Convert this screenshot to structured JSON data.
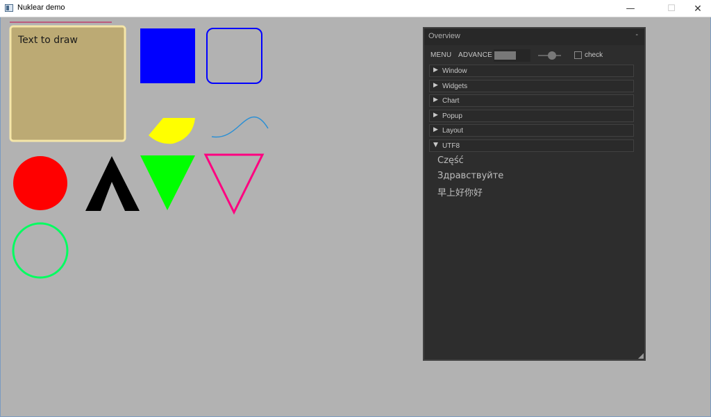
{
  "window": {
    "title": "Nuklear demo",
    "controls": {
      "minimize": "—",
      "maximize": "☐",
      "close": "✕"
    }
  },
  "canvas": {
    "background": "#b2b2b2",
    "text_box": {
      "text": "Text to draw",
      "fill": "#bcaa74",
      "border": "#f5e6a8"
    },
    "shapes": [
      {
        "kind": "filled-square",
        "color": "#0000ff"
      },
      {
        "kind": "outlined-rounded-square",
        "color": "#0000ff"
      },
      {
        "kind": "filled-arc",
        "color": "#ffff00"
      },
      {
        "kind": "curve",
        "color": "#2b8fd4"
      },
      {
        "kind": "filled-circle",
        "color": "#ff0000"
      },
      {
        "kind": "thick-polyline",
        "color": "#000000"
      },
      {
        "kind": "filled-triangle",
        "color": "#00ff00"
      },
      {
        "kind": "outlined-triangle",
        "color": "#ff0080"
      },
      {
        "kind": "outlined-circle",
        "color": "#00ff60"
      },
      {
        "kind": "line",
        "color": "#c0406a"
      }
    ]
  },
  "overview": {
    "title": "Overview",
    "minimize_symbol": "-",
    "menubar": {
      "menu_label": "MENU",
      "advance_label": "ADVANCE",
      "progress": 0.6,
      "slider": 0.6,
      "checkbox_label": "check",
      "checked": false
    },
    "tree": [
      {
        "label": "Window",
        "arrow": "▶"
      },
      {
        "label": "Widgets",
        "arrow": "▶"
      },
      {
        "label": "Chart",
        "arrow": "▶"
      },
      {
        "label": "Popup",
        "arrow": "▶"
      },
      {
        "label": "Layout",
        "arrow": "▶"
      },
      {
        "label": "UTF8",
        "arrow": "▼"
      }
    ],
    "utf8_lines": [
      "Część",
      "Здравствуйте",
      "早上好你好"
    ]
  }
}
